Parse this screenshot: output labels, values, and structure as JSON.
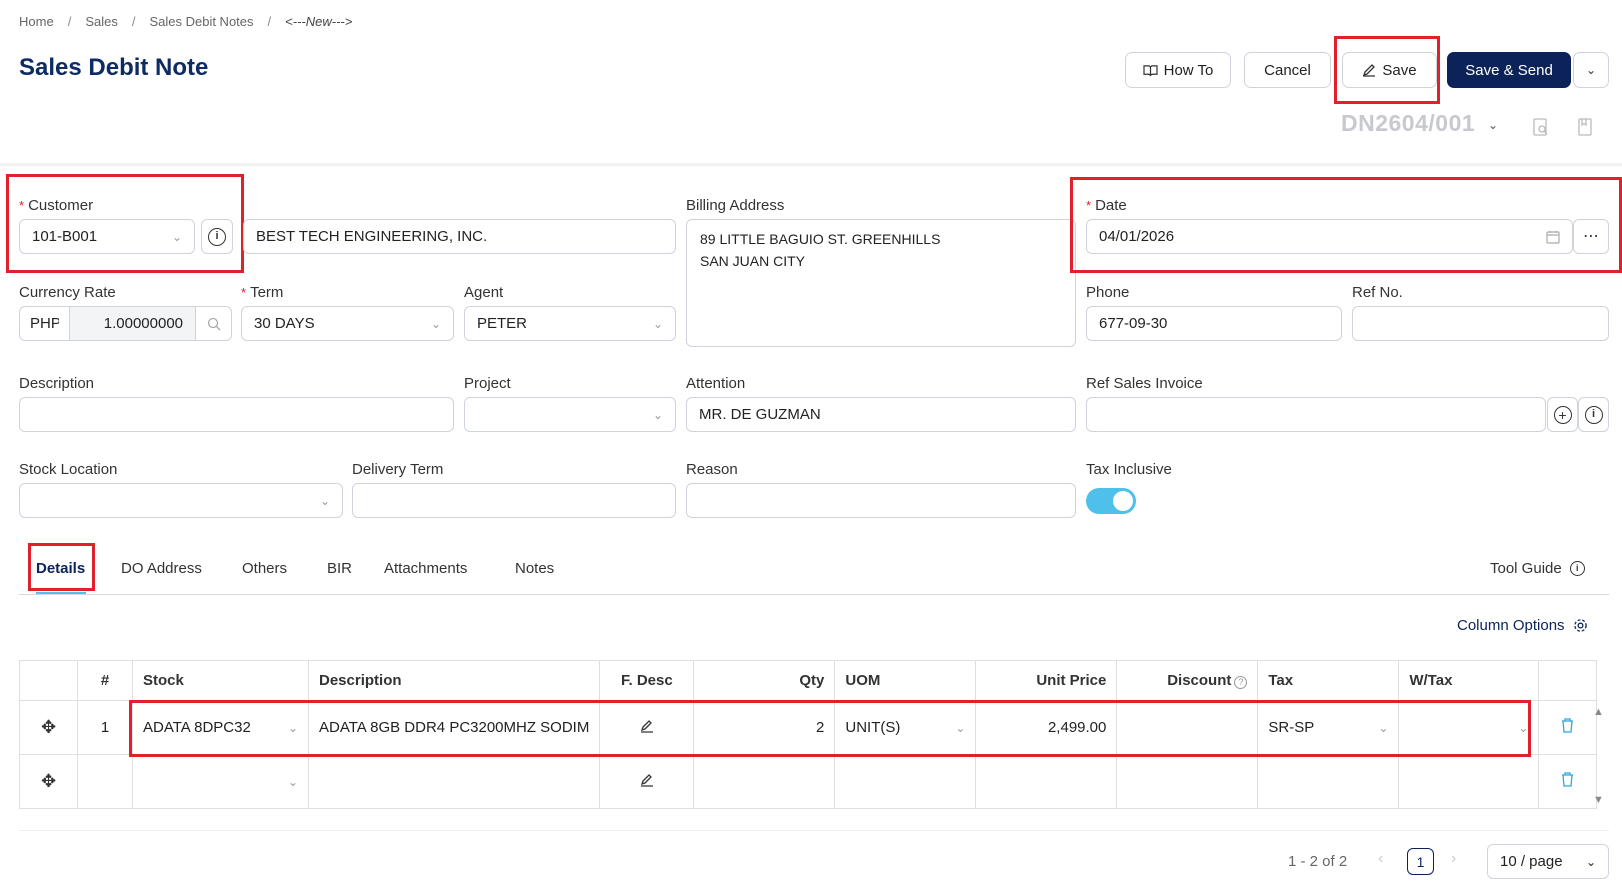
{
  "breadcrumb": [
    "Home",
    "Sales",
    "Sales Debit Notes",
    "<---New--->"
  ],
  "page_title": "Sales Debit Note",
  "header_buttons": {
    "how_to": "How To",
    "cancel": "Cancel",
    "save": "Save",
    "save_send": "Save & Send"
  },
  "doc_no": "DN2604/001",
  "fields": {
    "customer_label": "Customer",
    "customer_code": "101-B001",
    "customer_name": "BEST TECH ENGINEERING, INC.",
    "billing_label": "Billing Address",
    "billing_line1": "89 LITTLE BAGUIO ST. GREENHILLS",
    "billing_line2": "SAN JUAN CITY",
    "date_label": "Date",
    "date_value": "04/01/2026",
    "currency_label": "Currency Rate",
    "currency_code": "PHP",
    "currency_rate": "1.00000000",
    "term_label": "Term",
    "term_value": "30 DAYS",
    "agent_label": "Agent",
    "agent_value": "PETER",
    "phone_label": "Phone",
    "phone_value": "677-09-30",
    "refno_label": "Ref No.",
    "refno_value": "",
    "description_label": "Description",
    "description_value": "",
    "project_label": "Project",
    "project_value": "",
    "attention_label": "Attention",
    "attention_value": "MR. DE GUZMAN",
    "ref_invoice_label": "Ref Sales Invoice",
    "ref_invoice_value": "",
    "stock_location_label": "Stock Location",
    "stock_location_value": "",
    "delivery_term_label": "Delivery Term",
    "delivery_term_value": "",
    "reason_label": "Reason",
    "reason_value": "",
    "tax_inclusive_label": "Tax Inclusive",
    "tax_inclusive_on": true
  },
  "tabs": [
    "Details",
    "DO Address",
    "Others",
    "BIR",
    "Attachments",
    "Notes"
  ],
  "tool_guide": "Tool Guide",
  "column_options": "Column Options",
  "table": {
    "headers": [
      "#",
      "Stock",
      "Description",
      "F. Desc",
      "Qty",
      "UOM",
      "Unit Price",
      "Discount",
      "Tax",
      "W/Tax"
    ],
    "rows": [
      {
        "no": "1",
        "stock": "ADATA 8DPC32",
        "description": "ADATA 8GB DDR4 PC3200MHZ SODIM",
        "qty": "2",
        "uom": "UNIT(S)",
        "unit_price": "2,499.00",
        "discount": "",
        "tax": "SR-SP",
        "wtax": ""
      },
      {
        "no": "",
        "stock": "",
        "description": "",
        "qty": "",
        "uom": "",
        "unit_price": "",
        "discount": "",
        "tax": "",
        "wtax": ""
      }
    ]
  },
  "pagination": {
    "range": "1 - 2 of 2",
    "current_page": "1",
    "page_size": "10 / page"
  },
  "colors": {
    "accent": "#0b2358",
    "highlight": "#e0202a",
    "toggle": "#4fc0ea"
  }
}
